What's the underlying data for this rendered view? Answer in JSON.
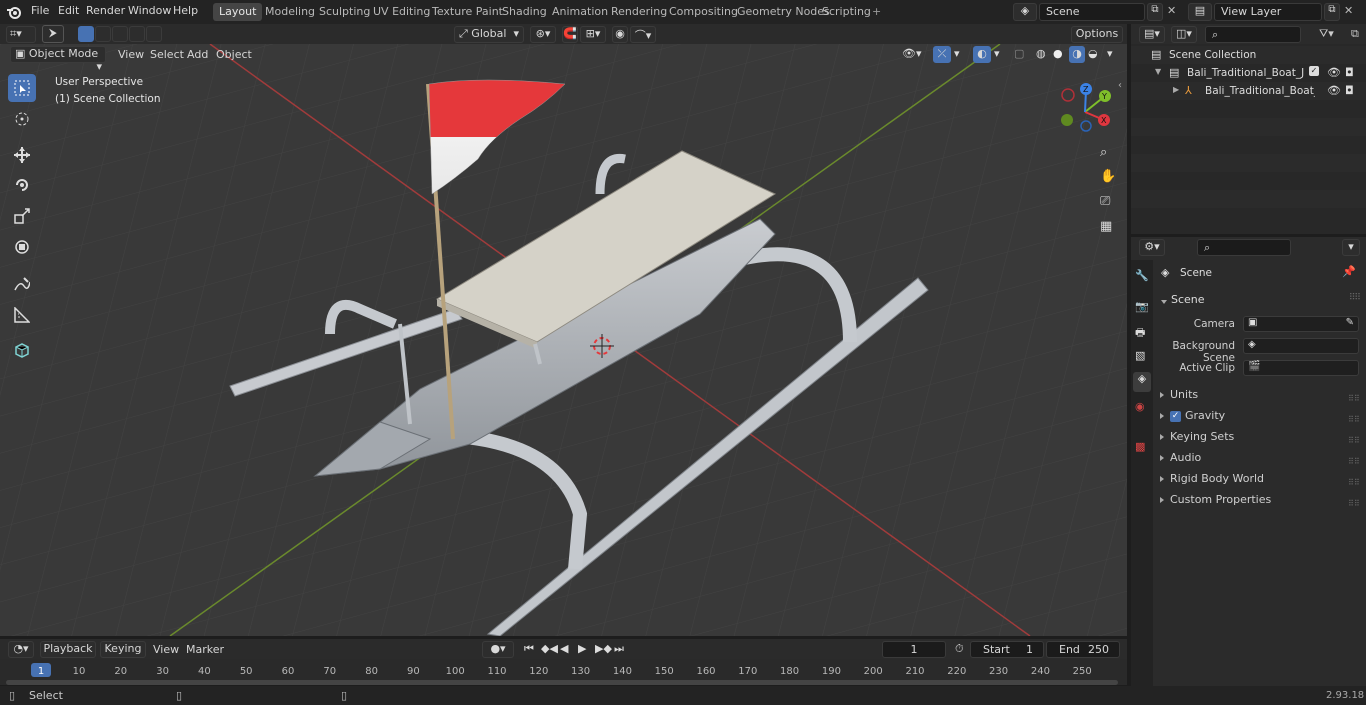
{
  "menu": [
    "File",
    "Edit",
    "Render",
    "Window",
    "Help"
  ],
  "workspaces": [
    "Layout",
    "Modeling",
    "Sculpting",
    "UV Editing",
    "Texture Paint",
    "Shading",
    "Animation",
    "Rendering",
    "Compositing",
    "Geometry Nodes",
    "Scripting"
  ],
  "active_workspace": "Layout",
  "scene_name": "Scene",
  "view_layer": "View Layer",
  "viewport_header": {
    "mode": "Object Mode",
    "menus": [
      "View",
      "Select",
      "Add",
      "Object"
    ],
    "transform_orientation": "Global",
    "options_label": "Options"
  },
  "viewport_overlay": {
    "perspective": "User Perspective",
    "collection": "(1) Scene Collection"
  },
  "outliner": {
    "root": "Scene Collection",
    "items": [
      "Bali_Traditional_Boat_Jukung_",
      "Bali_Traditional_Boat_Juk"
    ]
  },
  "properties": {
    "context": "Scene",
    "panel": "Scene",
    "fields": [
      {
        "label": "Camera",
        "value": ""
      },
      {
        "label": "Background Scene",
        "value": ""
      },
      {
        "label": "Active Clip",
        "value": ""
      }
    ],
    "sections": [
      "Units",
      "Gravity",
      "Keying Sets",
      "Audio",
      "Rigid Body World",
      "Custom Properties"
    ],
    "gravity_checked": true
  },
  "timeline": {
    "menus": [
      "Playback",
      "Keying",
      "View",
      "Marker"
    ],
    "current_frame": "1",
    "start_label": "Start",
    "start": "1",
    "end_label": "End",
    "end": "250",
    "ticks": [
      "1",
      "10",
      "20",
      "30",
      "40",
      "50",
      "60",
      "70",
      "80",
      "90",
      "100",
      "110",
      "120",
      "130",
      "140",
      "150",
      "160",
      "170",
      "180",
      "190",
      "200",
      "210",
      "220",
      "230",
      "240",
      "250"
    ]
  },
  "status": {
    "left": "Select",
    "version": "2.93.18"
  },
  "colors": {
    "accent": "#4772b3",
    "x_axis": "#e0363f",
    "y_axis": "#7fbf2a",
    "z_axis": "#3b82e6",
    "flag_red": "#e5383b"
  }
}
